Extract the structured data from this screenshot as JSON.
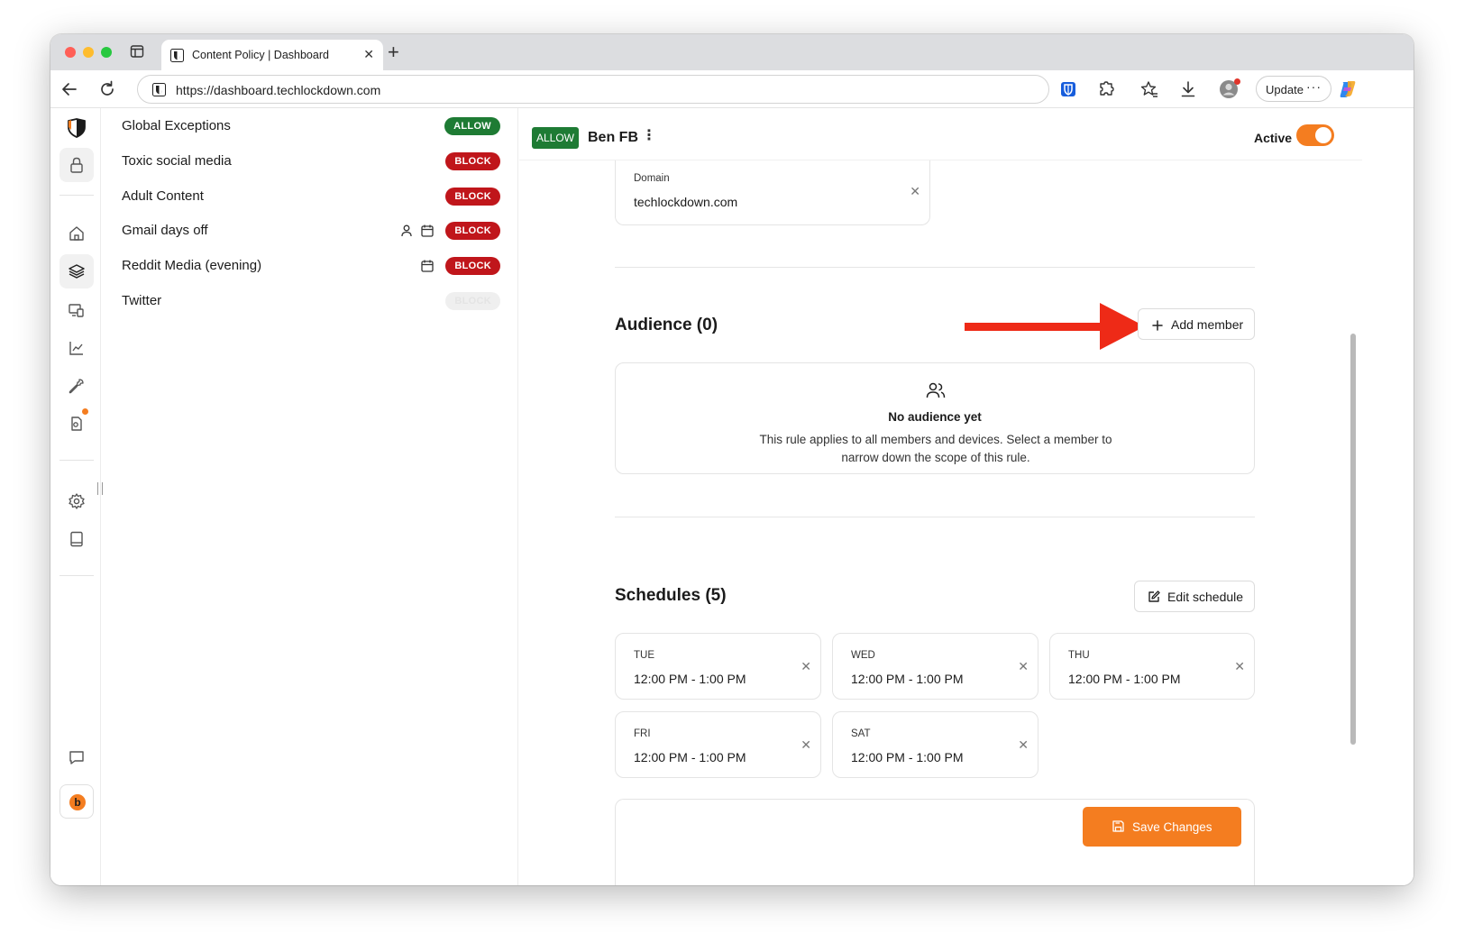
{
  "browser": {
    "tab_title": "Content Policy | Dashboard",
    "url": "https://dashboard.techlockdown.com",
    "update_label": "Update",
    "more_label": "···"
  },
  "rules": [
    {
      "name": "Global Exceptions",
      "action": "ALLOW",
      "icons": [],
      "enabled": true
    },
    {
      "name": "Toxic social media",
      "action": "BLOCK",
      "icons": [],
      "enabled": true
    },
    {
      "name": "Adult Content",
      "action": "BLOCK",
      "icons": [],
      "enabled": true
    },
    {
      "name": "Gmail days off",
      "action": "BLOCK",
      "icons": [
        "person-icon",
        "calendar-icon"
      ],
      "enabled": true
    },
    {
      "name": "Reddit Media (evening)",
      "action": "BLOCK",
      "icons": [
        "calendar-icon"
      ],
      "enabled": true
    },
    {
      "name": "Twitter",
      "action": "BLOCK",
      "icons": [],
      "enabled": false
    }
  ],
  "detail": {
    "action_badge": "ALLOW",
    "title": "Ben FB",
    "kebab": "⋮",
    "active_label": "Active",
    "active": true,
    "domain": {
      "label": "Domain",
      "value": "techlockdown.com"
    },
    "audience": {
      "title": "Audience (0)",
      "add_label": "Add member",
      "empty_title": "No audience yet",
      "empty_desc": "This rule applies to all members and devices. Select a member to narrow down the scope of this rule."
    },
    "schedules": {
      "title": "Schedules (5)",
      "edit_label": "Edit schedule",
      "items": [
        {
          "day": "TUE",
          "time": "12:00 PM - 1:00 PM"
        },
        {
          "day": "WED",
          "time": "12:00 PM - 1:00 PM"
        },
        {
          "day": "THU",
          "time": "12:00 PM - 1:00 PM"
        },
        {
          "day": "FRI",
          "time": "12:00 PM - 1:00 PM"
        },
        {
          "day": "SAT",
          "time": "12:00 PM - 1:00 PM"
        }
      ]
    },
    "save_label": "Save Changes"
  },
  "user": {
    "initial": "b"
  },
  "colors": {
    "accent": "#f47d20",
    "allow": "#1e7b34",
    "block": "#c0161b",
    "arrow": "#ee2a17"
  }
}
